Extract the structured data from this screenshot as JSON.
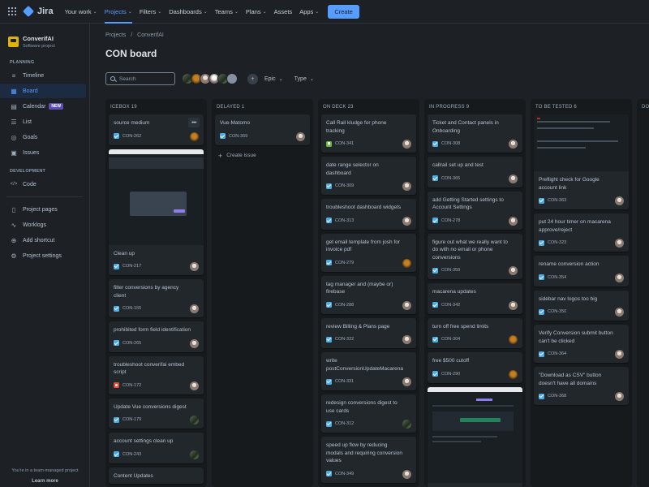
{
  "topbar": {
    "brand": "Jira",
    "nav": [
      {
        "label": "Your work",
        "active": false
      },
      {
        "label": "Projects",
        "active": true
      },
      {
        "label": "Filters",
        "active": false
      },
      {
        "label": "Dashboards",
        "active": false
      },
      {
        "label": "Teams",
        "active": false
      },
      {
        "label": "Plans",
        "active": false
      },
      {
        "label": "Assets",
        "active": false
      },
      {
        "label": "Apps",
        "active": false
      }
    ],
    "create_label": "Create"
  },
  "sidebar": {
    "project_name": "ConverifAI",
    "project_type": "Software project",
    "planning_label": "PLANNING",
    "development_label": "DEVELOPMENT",
    "items": [
      {
        "label": "Timeline",
        "icon": "timeline-icon",
        "active": false
      },
      {
        "label": "Board",
        "icon": "board-icon",
        "active": true
      },
      {
        "label": "Calendar",
        "icon": "calendar-icon",
        "active": false,
        "badge": "NEW"
      },
      {
        "label": "List",
        "icon": "list-icon",
        "active": false
      },
      {
        "label": "Goals",
        "icon": "goals-icon",
        "active": false
      },
      {
        "label": "Issues",
        "icon": "issues-icon",
        "active": false
      }
    ],
    "dev_items": [
      {
        "label": "Code",
        "icon": "code-icon"
      }
    ],
    "extra_items": [
      {
        "label": "Project pages",
        "icon": "pages-icon"
      },
      {
        "label": "Worklogs",
        "icon": "worklogs-icon"
      },
      {
        "label": "Add shortcut",
        "icon": "add-shortcut-icon"
      },
      {
        "label": "Project settings",
        "icon": "settings-icon"
      }
    ],
    "footer_text": "You're in a team-managed project",
    "footer_link": "Learn more"
  },
  "main": {
    "breadcrumb": [
      "Projects",
      "ConverifAI"
    ],
    "title": "CON board",
    "search_placeholder": "Search",
    "filters": [
      "Epic",
      "Type"
    ]
  },
  "columns": [
    {
      "header": "ICEBOX 19",
      "cards": [
        {
          "title": "source medium",
          "key": "CON-262",
          "type": "task",
          "avatar": "av-b",
          "more": true
        },
        {
          "title": "Clean up",
          "key": "CON-217",
          "type": "task",
          "avatar": "av-a",
          "thumb": true
        },
        {
          "title": "filter conversions by agency client",
          "key": "CON-155",
          "type": "task",
          "avatar": "av-a"
        },
        {
          "title": "prohibited form field identification",
          "key": "CON-265",
          "type": "task",
          "avatar": "av-a"
        },
        {
          "title": "troubleshoot converifai embed script",
          "key": "CON-172",
          "type": "bug",
          "avatar": "av-a"
        },
        {
          "title": "Update Vue conversions digest",
          "key": "CON-179",
          "type": "task",
          "avatar": "av-c"
        },
        {
          "title": "account settings clean up",
          "key": "CON-243",
          "type": "task",
          "avatar": "av-c"
        },
        {
          "title": "Content Updates",
          "key": "",
          "type": "task",
          "avatar": ""
        }
      ]
    },
    {
      "header": "DELAYED 1",
      "cards": [
        {
          "title": "Vue-Matomo",
          "key": "CON-369",
          "type": "task",
          "avatar": "av-a"
        }
      ],
      "create_issue": "Create issue"
    },
    {
      "header": "ON DECK 23",
      "cards": [
        {
          "title": "Call Rail kludge for phone tracking",
          "key": "CON-341",
          "type": "story",
          "avatar": "av-a"
        },
        {
          "title": "date range selector on dashboard",
          "key": "CON-309",
          "type": "task",
          "avatar": "av-a"
        },
        {
          "title": "troubleshoot dashboard widgets",
          "key": "CON-313",
          "type": "task",
          "avatar": "av-a"
        },
        {
          "title": "get email template from josh for invoice pdf",
          "key": "CON-279",
          "type": "task",
          "avatar": "av-b"
        },
        {
          "title": "tag manager and (maybe or) firebase",
          "key": "CON-288",
          "type": "task",
          "avatar": "av-a"
        },
        {
          "title": "review Billing & Plans page",
          "key": "CON-322",
          "type": "task",
          "avatar": "av-a"
        },
        {
          "title": "write postConversionUpdateMacarena",
          "key": "CON-331",
          "type": "task",
          "avatar": "av-a"
        },
        {
          "title": "redesign conversions digest to use cards",
          "key": "CON-312",
          "type": "task",
          "avatar": "av-c"
        },
        {
          "title": "speed up flow by reducing modals and requiring conversion values",
          "key": "CON-349",
          "type": "task",
          "avatar": "av-a"
        }
      ]
    },
    {
      "header": "IN PROGRESS 9",
      "cards": [
        {
          "title": "Ticket and Contact panels in Onboarding",
          "key": "CON-308",
          "type": "task",
          "avatar": "av-a"
        },
        {
          "title": "callrail set up and test",
          "key": "CON-365",
          "type": "task",
          "avatar": "av-a"
        },
        {
          "title": "add Getting Started settings to Account Settings",
          "key": "CON-278",
          "type": "task",
          "avatar": "av-a"
        },
        {
          "title": "figure out what we really want to do with no email or phone conversions",
          "key": "CON-359",
          "type": "task",
          "avatar": "av-a"
        },
        {
          "title": "macarena updates",
          "key": "CON-342",
          "type": "task",
          "avatar": "av-a"
        },
        {
          "title": "turn off free spend limits",
          "key": "CON-304",
          "type": "task",
          "avatar": "av-b"
        },
        {
          "title": "free $500 cutoff",
          "key": "CON-290",
          "type": "task",
          "avatar": "av-b"
        },
        {
          "title": "",
          "key": "",
          "type": "task",
          "avatar": "",
          "thumb": true
        }
      ]
    },
    {
      "header": "TO BE TESTED 6",
      "cards": [
        {
          "title": "Preflight check for Google account link",
          "key": "CON-363",
          "type": "task",
          "avatar": "av-a",
          "thumb": true
        },
        {
          "title": "put 24 hour timer on macarena approve/reject",
          "key": "CON-323",
          "type": "task",
          "avatar": "av-a"
        },
        {
          "title": "rename conversion action",
          "key": "CON-354",
          "type": "task",
          "avatar": "av-a"
        },
        {
          "title": "sidebar nav logos too big",
          "key": "CON-350",
          "type": "task",
          "avatar": "av-a"
        },
        {
          "title": "Verify Conversion submit button can't be clicked",
          "key": "CON-364",
          "type": "task",
          "avatar": "av-a"
        },
        {
          "title": "\"Download as CSV\" button doesn't have all domains",
          "key": "CON-368",
          "type": "task",
          "avatar": "av-a"
        }
      ]
    },
    {
      "header": "DO",
      "cards": []
    }
  ],
  "colors": {
    "accent": "#579dff",
    "background": "#1d2125",
    "column": "#161a1d",
    "card": "#22272b"
  }
}
